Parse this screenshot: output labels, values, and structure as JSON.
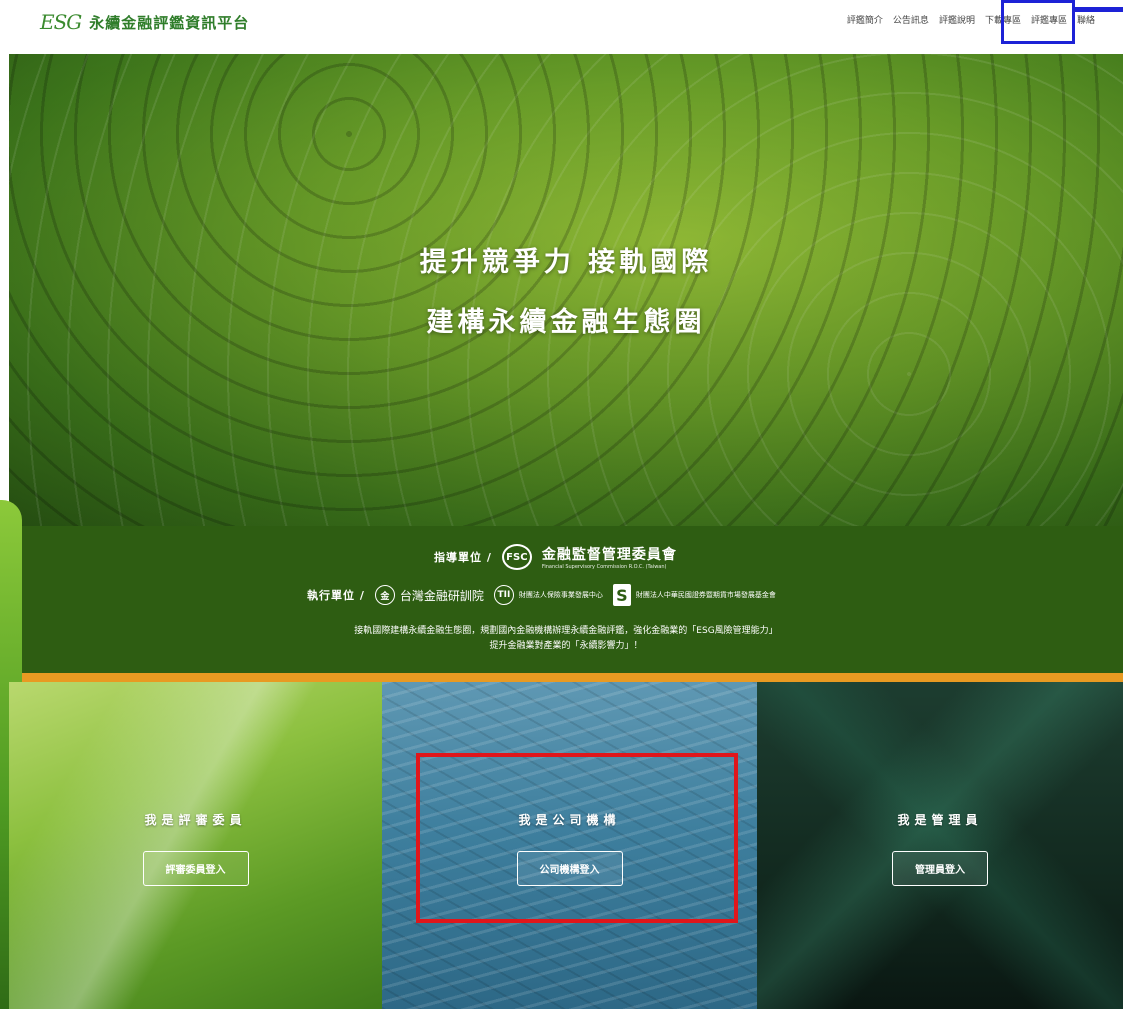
{
  "header": {
    "logo_mark": "ESG",
    "logo_text": "永續金融評鑑資訊平台",
    "nav": [
      "評鑑簡介",
      "公告訊息",
      "評鑑說明",
      "下載專區",
      "評鑑專區",
      "聯絡"
    ]
  },
  "hero": {
    "line1": "提升競爭力 接軌國際",
    "line2": "建構永續金融生態圈"
  },
  "band": {
    "guide_label": "指導單位 /",
    "guide_org": "金融監督管理委員會",
    "guide_org_sub": "Financial Supervisory Commission R.O.C. (Taiwan)",
    "exec_label": "執行單位 /",
    "exec_org1": "台灣金融研訓院",
    "exec_org2": "財團法人保險事業發展中心",
    "exec_org3": "財團法人中華民國證券暨期貨市場發展基金會",
    "desc1": "接軌國際建構永續金融生態圈，規劃國內金融機構辦理永續金融評鑑，強化金融業的「ESG風險管理能力」",
    "desc2": "提升金融業對產業的「永續影響力」！"
  },
  "panels": [
    {
      "title": "我是評審委員",
      "button": "評審委員登入"
    },
    {
      "title": "我是公司機構",
      "button": "公司機構登入"
    },
    {
      "title": "我是管理員",
      "button": "管理員登入"
    }
  ],
  "colors": {
    "brand_green": "#2e5d12",
    "accent_orange": "#e89a22",
    "highlight_blue": "#1d22d6",
    "highlight_red": "#e0161b"
  }
}
